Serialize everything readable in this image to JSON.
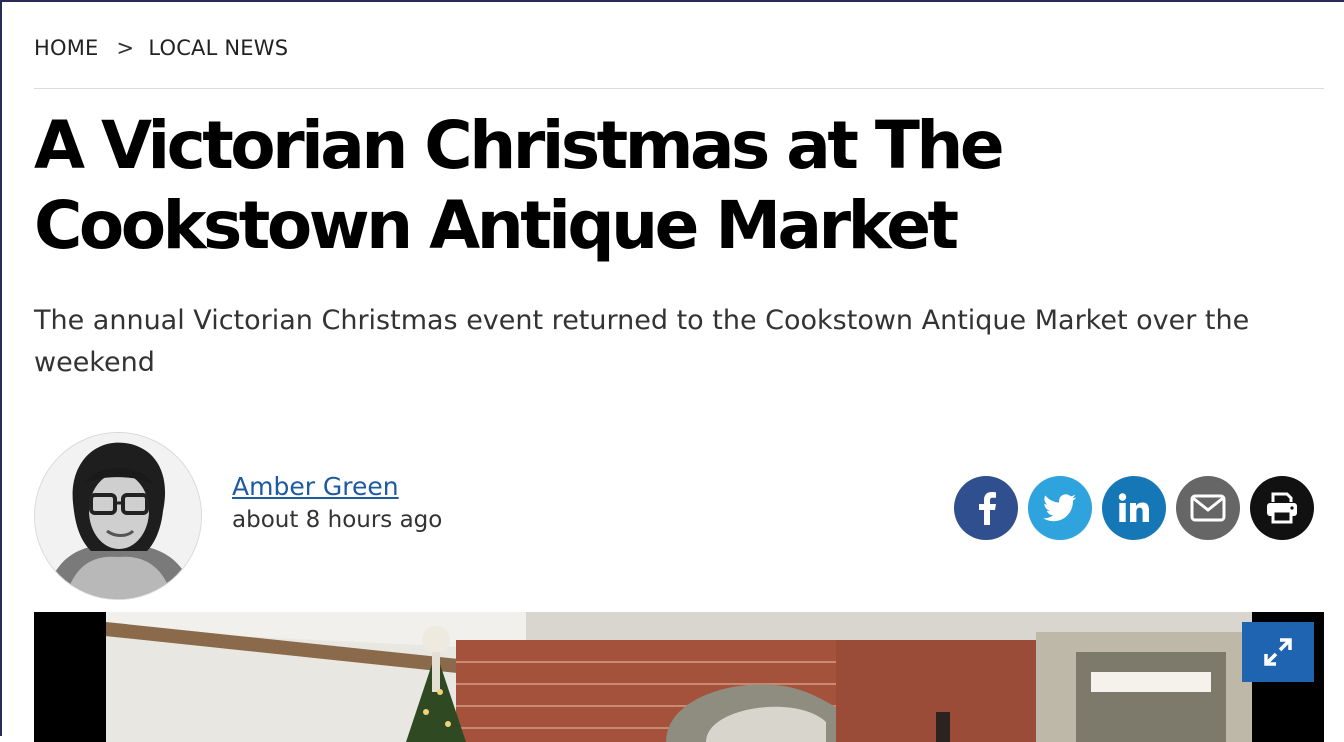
{
  "breadcrumb": {
    "home": "HOME",
    "separator": ">",
    "section": "LOCAL NEWS"
  },
  "article": {
    "title": "A Victorian Christmas at The Cookstown Antique Market",
    "subhead": "The annual Victorian Christmas event returned to the Cookstown Antique Market over the weekend"
  },
  "author": {
    "name": "Amber Green",
    "published": "about 8 hours ago"
  },
  "share": {
    "buttons": [
      {
        "icon": "facebook-icon",
        "color": "#2f4f8e"
      },
      {
        "icon": "twitter-icon",
        "color": "#2ea3dd"
      },
      {
        "icon": "linkedin-icon",
        "color": "#1677b7"
      },
      {
        "icon": "email-icon",
        "color": "#666666"
      },
      {
        "icon": "print-icon",
        "color": "#111111"
      }
    ]
  },
  "colors": {
    "link": "#1e5aa0",
    "expand_button": "#1f64b0"
  }
}
